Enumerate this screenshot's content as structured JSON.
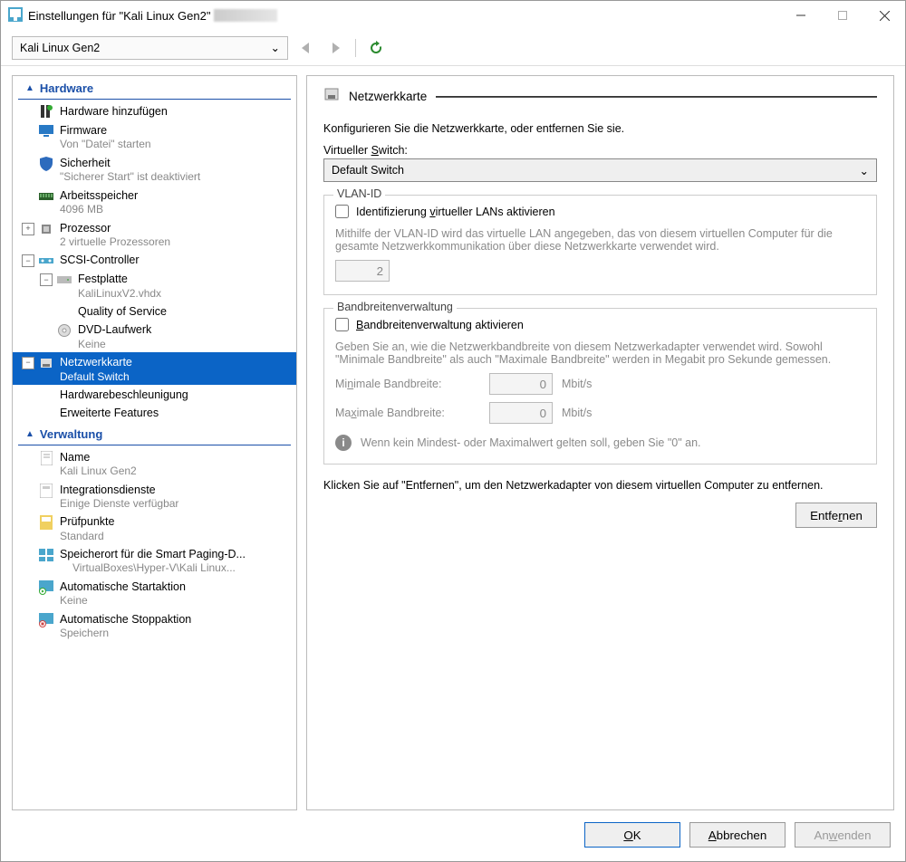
{
  "window": {
    "title": "Einstellungen für \"Kali Linux Gen2\""
  },
  "toolbar": {
    "vm_name": "Kali Linux Gen2"
  },
  "sidebar": {
    "hardware_header": "Hardware",
    "verwaltung_header": "Verwaltung",
    "add_hw": "Hardware hinzufügen",
    "firmware": {
      "label": "Firmware",
      "sub": "Von \"Datei\" starten"
    },
    "security": {
      "label": "Sicherheit",
      "sub": "\"Sicherer Start\" ist deaktiviert"
    },
    "memory": {
      "label": "Arbeitsspeicher",
      "sub": "4096 MB"
    },
    "cpu": {
      "label": "Prozessor",
      "sub": "2 virtuelle Prozessoren"
    },
    "scsi": {
      "label": "SCSI-Controller"
    },
    "hdd": {
      "label": "Festplatte",
      "sub": "KaliLinuxV2.vhdx"
    },
    "qos": {
      "label": "Quality of Service"
    },
    "dvd": {
      "label": "DVD-Laufwerk",
      "sub": "Keine"
    },
    "nic": {
      "label": "Netzwerkkarte",
      "sub": "Default Switch"
    },
    "hwaccel": {
      "label": "Hardwarebeschleunigung"
    },
    "advfeat": {
      "label": "Erweiterte Features"
    },
    "name": {
      "label": "Name",
      "sub": "Kali Linux Gen2"
    },
    "integ": {
      "label": "Integrationsdienste",
      "sub": "Einige Dienste verfügbar"
    },
    "checkpoints": {
      "label": "Prüfpunkte",
      "sub": "Standard"
    },
    "smartpaging": {
      "label": "Speicherort für die Smart Paging-D...",
      "sub": "VirtualBoxes\\Hyper-V\\Kali Linux..."
    },
    "autostart": {
      "label": "Automatische Startaktion",
      "sub": "Keine"
    },
    "autostop": {
      "label": "Automatische Stoppaktion",
      "sub": "Speichern"
    }
  },
  "panel": {
    "title": "Netzwerkkarte",
    "desc": "Konfigurieren Sie die Netzwerkkarte, oder entfernen Sie sie.",
    "vswitch_label": "Virtueller Switch:",
    "vswitch_value": "Default Switch",
    "vlan": {
      "group": "VLAN-ID",
      "check": "Identifizierung virtueller LANs aktivieren",
      "help": "Mithilfe der VLAN-ID wird das virtuelle LAN angegeben, das von diesem virtuellen Computer für die gesamte Netzwerkkommunikation über diese Netzwerkkarte verwendet wird.",
      "value": "2"
    },
    "bw": {
      "group": "Bandbreitenverwaltung",
      "check": "Bandbreitenverwaltung aktivieren",
      "help": "Geben Sie an, wie die Netzwerkbandbreite von diesem Netzwerkadapter verwendet wird. Sowohl \"Minimale Bandbreite\" als auch \"Maximale Bandbreite\" werden in Megabit pro Sekunde gemessen.",
      "min_label": "Minimale Bandbreite:",
      "max_label": "Maximale Bandbreite:",
      "min_value": "0",
      "max_value": "0",
      "unit": "Mbit/s",
      "info": "Wenn kein Mindest- oder Maximalwert gelten soll, geben Sie \"0\" an."
    },
    "remove_desc": "Klicken Sie auf \"Entfernen\", um den Netzwerkadapter von diesem virtuellen Computer zu entfernen.",
    "remove_btn": "Entfernen"
  },
  "footer": {
    "ok": "OK",
    "cancel": "Abbrechen",
    "apply": "Anwenden"
  }
}
